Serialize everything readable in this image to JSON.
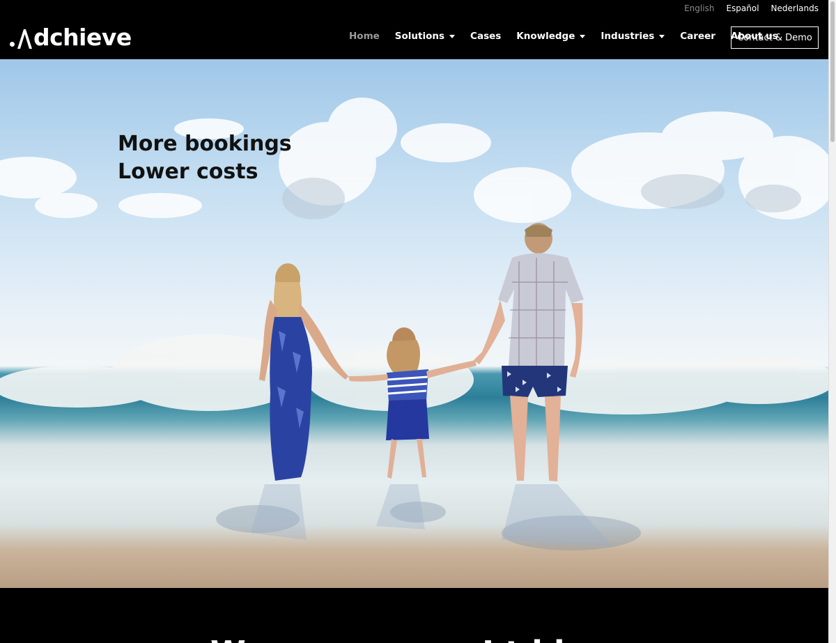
{
  "languages": [
    {
      "label": "English",
      "active": true
    },
    {
      "label": "Español",
      "active": false
    },
    {
      "label": "Nederlands",
      "active": false
    }
  ],
  "logo": {
    "text": "dchieve"
  },
  "nav": {
    "items": [
      {
        "label": "Home",
        "dropdown": false,
        "active": true
      },
      {
        "label": "Solutions",
        "dropdown": true
      },
      {
        "label": "Cases",
        "dropdown": false
      },
      {
        "label": "Knowledge",
        "dropdown": true
      },
      {
        "label": "Industries",
        "dropdown": true
      },
      {
        "label": "Career",
        "dropdown": false
      },
      {
        "label": "About us",
        "dropdown": false
      }
    ],
    "contact_label": "Contact & Demo"
  },
  "hero": {
    "line1": "More bookings",
    "line2": "Lower costs"
  },
  "teaser": {
    "left": "W",
    "right": "I t     i l"
  },
  "colors": {
    "background": "#000000",
    "nav_active": "#9a9a9a",
    "hero_text": "#111111"
  }
}
